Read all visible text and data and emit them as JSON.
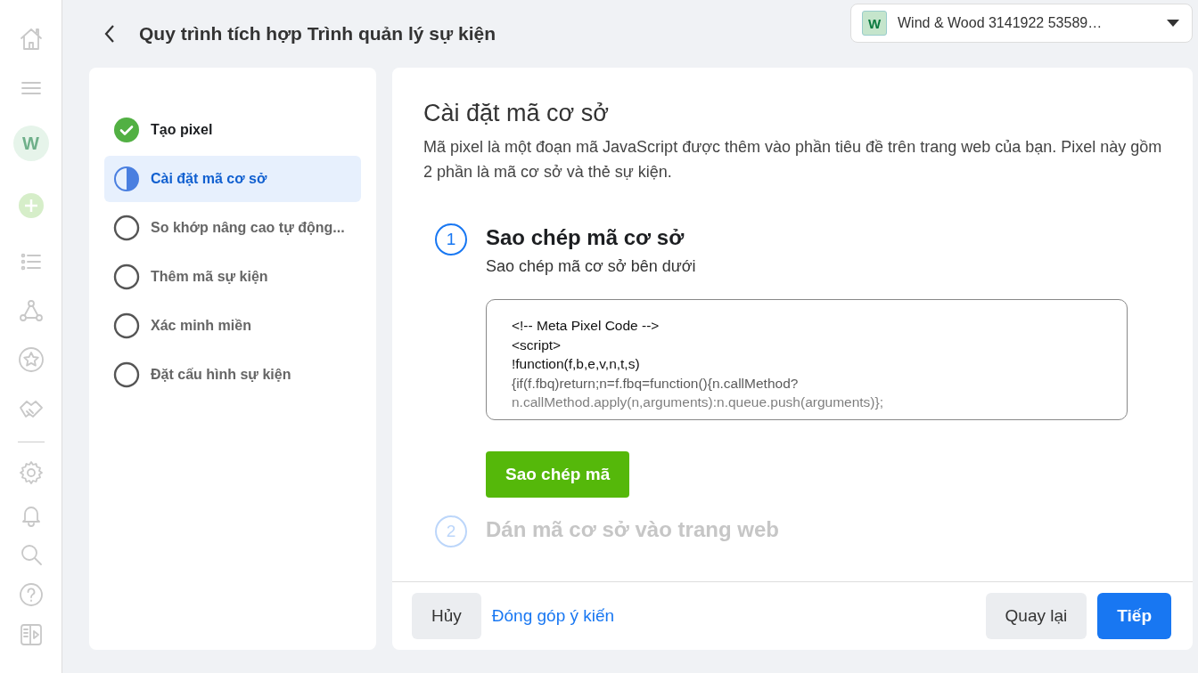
{
  "rail": {
    "avatar": "W"
  },
  "header": {
    "title": "Quy trình tích hợp Trình quản lý sự kiện",
    "account": {
      "badge": "W",
      "name": "Wind & Wood 3141922 53589…"
    }
  },
  "steps": [
    {
      "label": "Tạo pixel",
      "completed": true,
      "selected": false
    },
    {
      "label": "Cài đặt mã cơ sở",
      "completed": false,
      "selected": true
    },
    {
      "label": "So khớp nâng cao tự động...",
      "completed": false,
      "selected": false
    },
    {
      "label": "Thêm mã sự kiện",
      "completed": false,
      "selected": false
    },
    {
      "label": "Xác minh miền",
      "completed": false,
      "selected": false
    },
    {
      "label": "Đặt cấu hình sự kiện",
      "completed": false,
      "selected": false
    }
  ],
  "content": {
    "title": "Cài đặt mã cơ sở",
    "description": "Mã pixel là một đoạn mã JavaScript được thêm vào phần tiêu đề trên trang web của bạn. Pixel này gồm 2 phần là mã cơ sở và thẻ sự kiện.",
    "substeps": [
      {
        "number": "1",
        "title": "Sao chép mã cơ sở",
        "active": true,
        "subtitle": "Sao chép mã cơ sở bên dưới",
        "code": [
          "<!-- Meta Pixel Code -->",
          "<script>",
          "!function(f,b,e,v,n,t,s)",
          "{if(f.fbq)return;n=f.fbq=function(){n.callMethod?",
          "n.callMethod.apply(n,arguments):n.queue.push(arguments)};"
        ],
        "button": "Sao chép mã"
      },
      {
        "number": "2",
        "title": "Dán mã cơ sở vào trang web",
        "active": false
      }
    ]
  },
  "footer": {
    "cancel": "Hủy",
    "feedback": "Đóng góp ý kiến",
    "back": "Quay lại",
    "next": "Tiếp"
  }
}
